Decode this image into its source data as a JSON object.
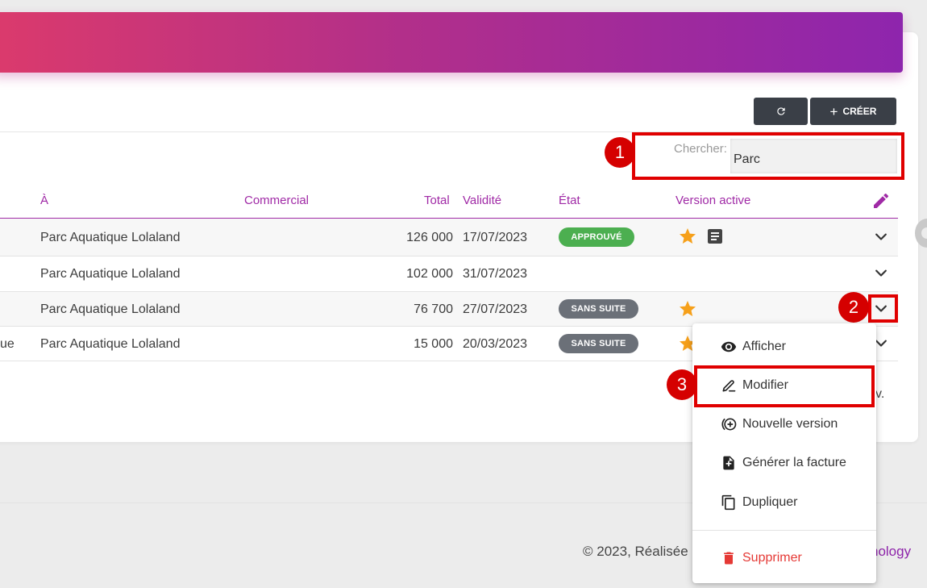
{
  "colors": {
    "accent": "#a02aa6",
    "banner_start": "#db3a6c",
    "banner_end": "#8e25ad",
    "approved": "#4caf50",
    "no_follow_up": "#6b7078",
    "star": "#f6a01a",
    "annotation": "#e00000",
    "danger": "#e53935"
  },
  "toolbar": {
    "refresh_icon": "refresh-icon",
    "create_label": "CRÉER",
    "create_icon": "plus-icon"
  },
  "search": {
    "label": "Chercher:",
    "value": "Parc"
  },
  "table": {
    "headers": {
      "to": "À",
      "salesperson": "Commercial",
      "total": "Total",
      "validity": "Validité",
      "status": "État",
      "active_version": "Version active",
      "edit_icon": "pencil-icon"
    },
    "rows": [
      {
        "left_fragment": "",
        "client": "Parc Aquatique Lolaland",
        "total": "126 000",
        "validity": "17/07/2023",
        "status": "APPROUVÉ",
        "star": true,
        "doc": true
      },
      {
        "left_fragment": "",
        "client": "Parc Aquatique Lolaland",
        "total": "102 000",
        "validity": "31/07/2023",
        "status": "",
        "star": false,
        "doc": false
      },
      {
        "left_fragment": "",
        "client": "Parc Aquatique Lolaland",
        "total": "76 700",
        "validity": "27/07/2023",
        "status": "SANS SUITE",
        "star": true,
        "doc": false
      },
      {
        "left_fragment": "ue",
        "client": "Parc Aquatique Lolaland",
        "total": "15 000",
        "validity": "20/03/2023",
        "status": "SANS SUITE",
        "star": true,
        "doc": false
      }
    ],
    "pagination_fragment": "v."
  },
  "annotations": [
    "1",
    "2",
    "3"
  ],
  "menu": {
    "items": [
      {
        "label": "Afficher",
        "icon": "eye-icon"
      },
      {
        "label": "Modifier",
        "icon": "pen-icon"
      },
      {
        "label": "Nouvelle version",
        "icon": "add-circle-icon"
      },
      {
        "label": "Générer la facture",
        "icon": "file-plus-icon"
      },
      {
        "label": "Dupliquer",
        "icon": "copy-icon"
      },
      {
        "label": "Supprimer",
        "icon": "trash-icon"
      }
    ]
  },
  "footer": {
    "copyright": "© 2023, Réalisée",
    "link_fragment": "nology"
  }
}
